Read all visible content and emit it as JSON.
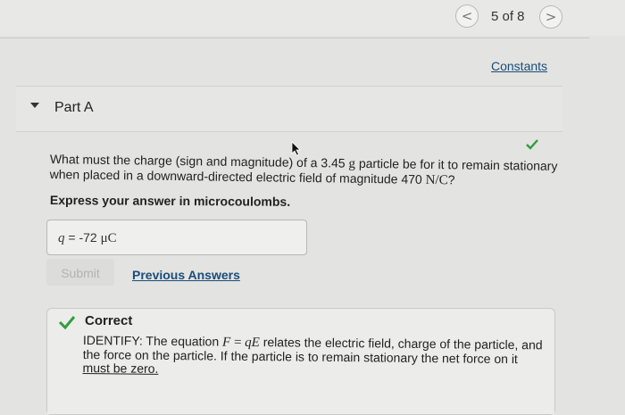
{
  "navigation": {
    "prev_icon": "chevron-left-icon",
    "next_icon": "chevron-right-icon",
    "counter": "5 of 8",
    "prev_glyph": "<",
    "next_glyph": ">"
  },
  "constants_link": "Constants",
  "part": {
    "toggle_icon": "triangle-down-icon",
    "title": "Part A"
  },
  "question": {
    "text_before_mass": "What must the charge (sign and magnitude) of a 3.45 ",
    "mass_unit": "g",
    "text_after_mass": " particle be for it to remain stationary when placed in a downward-directed electric field of magnitude 470 ",
    "field_unit": "N/C",
    "text_end": "?",
    "status_icon": "checkmark-icon"
  },
  "instruction": "Express your answer in microcoulombs.",
  "answer": {
    "variable": "q",
    "equals": "=",
    "value": "-72",
    "unit": "μC"
  },
  "buttons": {
    "submit": "Submit",
    "previous_answers": "Previous Answers"
  },
  "feedback": {
    "status": "Correct",
    "status_icon": "checkmark-icon",
    "text_start": "IDENTIFY: The equation ",
    "equation_F": "F",
    "equation_eq": " = ",
    "equation_q": "q",
    "equation_E": "E",
    "text_end": " relates the electric field, charge of the particle, and the force on the particle. If the particle is to remain stationary the net force on it ",
    "text_emphasis": "must be zero."
  },
  "colors": {
    "check_green": "#2f9e3f",
    "link_blue": "#1b4d7a"
  }
}
